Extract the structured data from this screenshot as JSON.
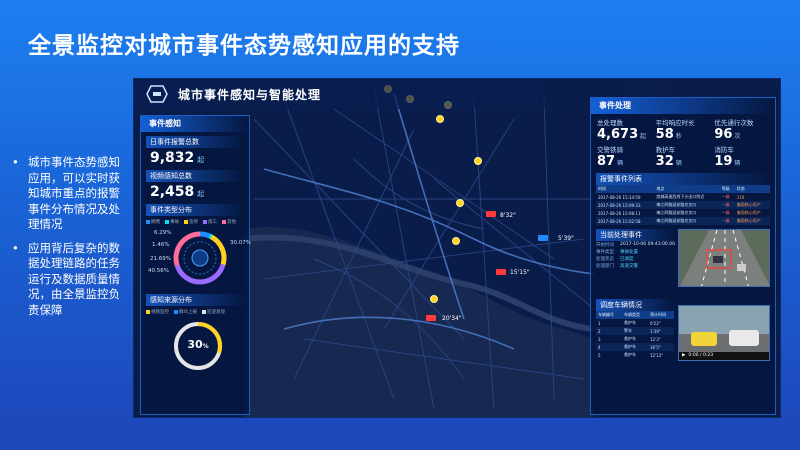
{
  "slide": {
    "title": "全景监控对城市事件态势感知应用的支持",
    "bullets": [
      {
        "dot": "•",
        "text": "城市事件态势感知应用，可以实时获知城市重点的报警事件分布情况及处理情况"
      },
      {
        "dot": "•",
        "text": "应用背后复杂的数据处理链路的任务运行及数据质量情况，由全景监控负责保障"
      }
    ]
  },
  "app": {
    "title": "城市事件感知与智能处理",
    "colors": {
      "accent": "#1e8bff",
      "warning": "#ffd21f",
      "alert": "#ff3b3b",
      "good": "#00e0ff"
    }
  },
  "left_panel": {
    "title": "事件感知",
    "daily_label": "日事件报警总数",
    "daily_value": "9,832",
    "daily_unit": "起",
    "video_label": "视频感知总数",
    "video_value": "2,458",
    "video_unit": "起",
    "type_title": "事件类型分布",
    "type_legend": [
      {
        "name": "拥堵",
        "color": "#1e8bff"
      },
      {
        "name": "事故",
        "color": "#00e0ff"
      },
      {
        "name": "违停",
        "color": "#ffd21f"
      },
      {
        "name": "施工",
        "color": "#9b6bff"
      },
      {
        "name": "其他",
        "color": "#ff6b9b"
      }
    ],
    "type_pcts": [
      "6.29%",
      "1.46%",
      "21.69%",
      "40.56%",
      "30.07%"
    ],
    "type_fracs": [
      0.0629,
      0.0146,
      0.2169,
      0.4056,
      0.3007
    ],
    "source_title": "感知来源分布",
    "source_legend": [
      {
        "name": "视频监控",
        "color": "#ffd21f"
      },
      {
        "name": "群众上报",
        "color": "#1e8bff"
      },
      {
        "name": "巡逻发现",
        "color": "#e5e5e5"
      }
    ],
    "source_value": "30",
    "source_unit": "%",
    "source_frac": 0.3
  },
  "right_panel": {
    "title": "事件处理",
    "stats": [
      {
        "label": "总处理数",
        "value": "4,673",
        "unit": "起"
      },
      {
        "label": "平均响应时长",
        "value": "58",
        "unit": "秒"
      },
      {
        "label": "优先通行次数",
        "value": "96",
        "unit": "次"
      },
      {
        "label": "交警铁骑",
        "value": "87",
        "unit": "辆"
      },
      {
        "label": "救护车",
        "value": "32",
        "unit": "辆"
      },
      {
        "label": "消防车",
        "value": "19",
        "unit": "辆"
      }
    ],
    "alarm_list_title": "报警事件列表",
    "alarm_columns": [
      "时间",
      "地点",
      "等级",
      "状态"
    ],
    "alarm_rows": [
      [
        "2017-08-26 15:14:59",
        "绕城高速西线下沙出口附近",
        "一级",
        "119"
      ],
      [
        "2017-08-26 15:09:33",
        "梅江四路延安路交叉口",
        "一级",
        "美丽热心用户"
      ],
      [
        "2017-08-26 15:08:11",
        "梅江四路延安路交叉口",
        "一级",
        "美丽热心用户"
      ],
      [
        "2017-08-26 15:02:58",
        "梅江四路延安路交叉口",
        "一级",
        "美丽热心用户"
      ]
    ],
    "current_title": "当前处理事件",
    "current_time_label": "开始时间",
    "current_time": "2017-10-06 09:43:00.00",
    "current_rows": [
      {
        "k": "事件类型",
        "v": "事故处置"
      },
      {
        "k": "处理状态",
        "v": "已调度"
      },
      {
        "k": "处理部门",
        "v": "高速交警"
      }
    ],
    "dispatch_title": "调度车辆情况",
    "dispatch_columns": [
      "车辆编号",
      "车辆类型",
      "预计时间"
    ],
    "dispatch_rows": [
      [
        "1",
        "救护车",
        "0'22\""
      ],
      [
        "2",
        "警车",
        "1'39\""
      ],
      [
        "3",
        "救护车",
        "12'3\""
      ],
      [
        "4",
        "救护车",
        "16'5\""
      ],
      [
        "5",
        "救护车",
        "12'12\""
      ]
    ],
    "video_time": "0:00 / 0:23"
  },
  "map": {
    "labels": [
      "8'32\"",
      "5'39\"",
      "15'15\"",
      "20'34\""
    ]
  }
}
